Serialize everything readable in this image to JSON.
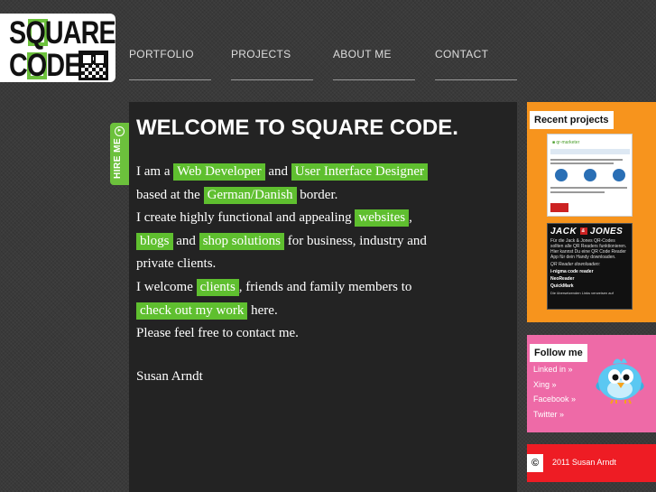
{
  "logo": {
    "line1": "SQUARE",
    "line2": "CODE",
    "icon": "qr-code-icon"
  },
  "nav": {
    "items": [
      {
        "label": "PORTFOLIO"
      },
      {
        "label": "PROJECTS"
      },
      {
        "label": "ABOUT ME"
      },
      {
        "label": "CONTACT"
      }
    ]
  },
  "hire": {
    "label": "HIRE ME",
    "icon": "play-circle-icon"
  },
  "main": {
    "title": "WELCOME TO SQUARE CODE.",
    "p": {
      "t1": "I am a ",
      "h1": "Web Developer",
      "t2": " and ",
      "h2": "User Interface Designer",
      "t3": "based at the ",
      "h3": "German/Danish",
      "t4": " border.",
      "t5": "I create highly functional and appealing ",
      "h4": "websites",
      "t6": ",",
      "h5": "blogs",
      "t7": " and ",
      "h6": "shop solutions",
      "t8": " for business, industry and",
      "t9": "private clients.",
      "t10": "I welcome ",
      "h7": "clients",
      "t11": ", friends and family members to",
      "h8": "check out my work",
      "t12": " here.",
      "t13": "Please feel free to contact me.",
      "signature": "Susan Arndt"
    },
    "highlight_color": "#5fbf2f"
  },
  "recent": {
    "heading": "Recent projects",
    "thumb1": {
      "logo": "qr-marketer"
    },
    "thumb2": {
      "brand": "JACK JONES",
      "badge": "&",
      "text1": "Für die Jack & Jones QR-Codes sollten alle QR Readers funktionieren. Hier kannst Du eine QR Code Reader App für dein Handy downloaden.",
      "text2": "QR Reader downloaden:",
      "link1": "i-nigma code reader",
      "link2": "NeoReader",
      "link3": "QuickMark",
      "text3": "Die übersetzenden Links verweisen auf"
    },
    "color": "#f7941d"
  },
  "follow": {
    "heading": "Follow me",
    "links": [
      {
        "label": "Linked in »"
      },
      {
        "label": "Xing »"
      },
      {
        "label": "Facebook »"
      },
      {
        "label": "Twitter »"
      }
    ],
    "mascot": "twitter-bird-icon",
    "color": "#ee6aa7"
  },
  "footer": {
    "copyright_symbol": "©",
    "text": "2011 Susan Arndt",
    "color": "#ee1c24"
  }
}
